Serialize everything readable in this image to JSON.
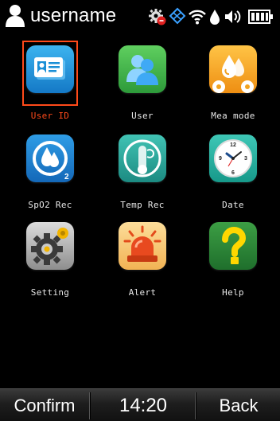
{
  "status": {
    "username": "username"
  },
  "apps": [
    {
      "label": "User ID",
      "icon": "id-card-icon",
      "selected": true
    },
    {
      "label": "User",
      "icon": "users-icon"
    },
    {
      "label": "Mea mode",
      "icon": "drops-gears-icon"
    },
    {
      "label": "SpO2 Rec",
      "icon": "spo2-drops-icon"
    },
    {
      "label": "Temp Rec",
      "icon": "thermometer-icon"
    },
    {
      "label": "Date",
      "icon": "clock-icon"
    },
    {
      "label": "Setting",
      "icon": "gear-icon"
    },
    {
      "label": "Alert",
      "icon": "alarm-light-icon"
    },
    {
      "label": "Help",
      "icon": "question-icon"
    }
  ],
  "clock": {
    "number_12": "12",
    "number_3": "3",
    "number_6": "6",
    "number_9": "9"
  },
  "spo2_sub": "2",
  "bottom": {
    "confirm_label": "Confirm",
    "time": "14:20",
    "back_label": "Back"
  },
  "colors": {
    "selected": "#ff4a1a",
    "user_id_tile": "#1a8fd6",
    "user_tile": "#3bb54a",
    "mea_tile": "#f5a623",
    "spo2_tile": "#1d7ccc",
    "temp_tile": "#2aa79b",
    "date_tile": "#22a99a",
    "setting_tile": "#a8a8a8",
    "alert_tile": "#f6c770",
    "help_tile": "#2c8a3a"
  }
}
